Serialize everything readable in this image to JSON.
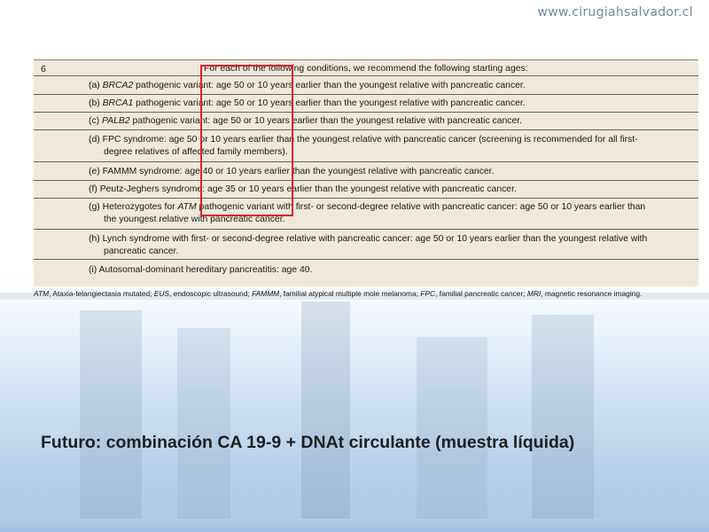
{
  "header": {
    "site_url": "www.cirugiahsalvador.cl"
  },
  "table": {
    "row_number": "6",
    "intro": "For each of the following conditions, we recommend the following starting ages:",
    "items": [
      {
        "prefix": "(a) ",
        "term": "BRCA2",
        "rest": " pathogenic variant: age 50 or 10 years earlier than the youngest relative with pancreatic cancer.",
        "cont": ""
      },
      {
        "prefix": "(b) ",
        "term": "BRCA1",
        "rest": " pathogenic variant: age 50 or 10 years earlier than the youngest relative with pancreatic cancer.",
        "cont": ""
      },
      {
        "prefix": "(c) ",
        "term": "PALB2",
        "rest": " pathogenic variant: age 50 or 10 years earlier than the youngest relative with pancreatic cancer.",
        "cont": ""
      },
      {
        "prefix": "(d) ",
        "term": "",
        "rest": "FPC syndrome: age 50 or 10 years earlier than the youngest relative with pancreatic cancer (screening is recommended for all first-",
        "cont": "degree relatives of affected family members)."
      },
      {
        "prefix": "(e) ",
        "term": "",
        "rest": "FAMMM syndrome: age 40 or 10 years earlier than the youngest relative with pancreatic cancer.",
        "cont": ""
      },
      {
        "prefix": "(f) ",
        "term": "",
        "rest": "Peutz-Jeghers syndrome: age 35 or 10 years earlier than the youngest relative with pancreatic cancer.",
        "cont": ""
      },
      {
        "prefix": "(g) Heterozygotes for ",
        "term": "ATM",
        "rest": " pathogenic variant with first- or second-degree relative with pancreatic cancer: age 50 or 10 years earlier than",
        "cont": "the youngest relative with pancreatic cancer."
      },
      {
        "prefix": "(h) ",
        "term": "",
        "rest": "Lynch syndrome with first- or second-degree relative with pancreatic cancer: age 50 or 10 years earlier than the youngest relative with",
        "cont": "pancreatic cancer."
      },
      {
        "prefix": "(i) ",
        "term": "",
        "rest": "Autosomal-dominant hereditary pancreatitis: age 40.",
        "cont": ""
      }
    ]
  },
  "footnote": {
    "atm_abbr": "ATM",
    "atm_def": ", Ataxia-telangiectasia mutated; ",
    "eus_abbr": "EUS",
    "eus_def": ", endoscopic ultrasound; ",
    "fammm_abbr": "FAMMM",
    "fammm_def": ", familial atypical multiple mole melanoma; ",
    "fpc_abbr": "FPC",
    "fpc_def": ", familial pancreatic cancer; ",
    "mri_abbr": "MRI",
    "mri_def": ", magnetic resonance imaging."
  },
  "slide_title": "Futuro: combinación CA 19-9 + DNAt circulante (muestra líquida)",
  "colors": {
    "highlight": "#e0202a",
    "table_bg": "#efe8db",
    "url_color": "#6f8aa6"
  }
}
